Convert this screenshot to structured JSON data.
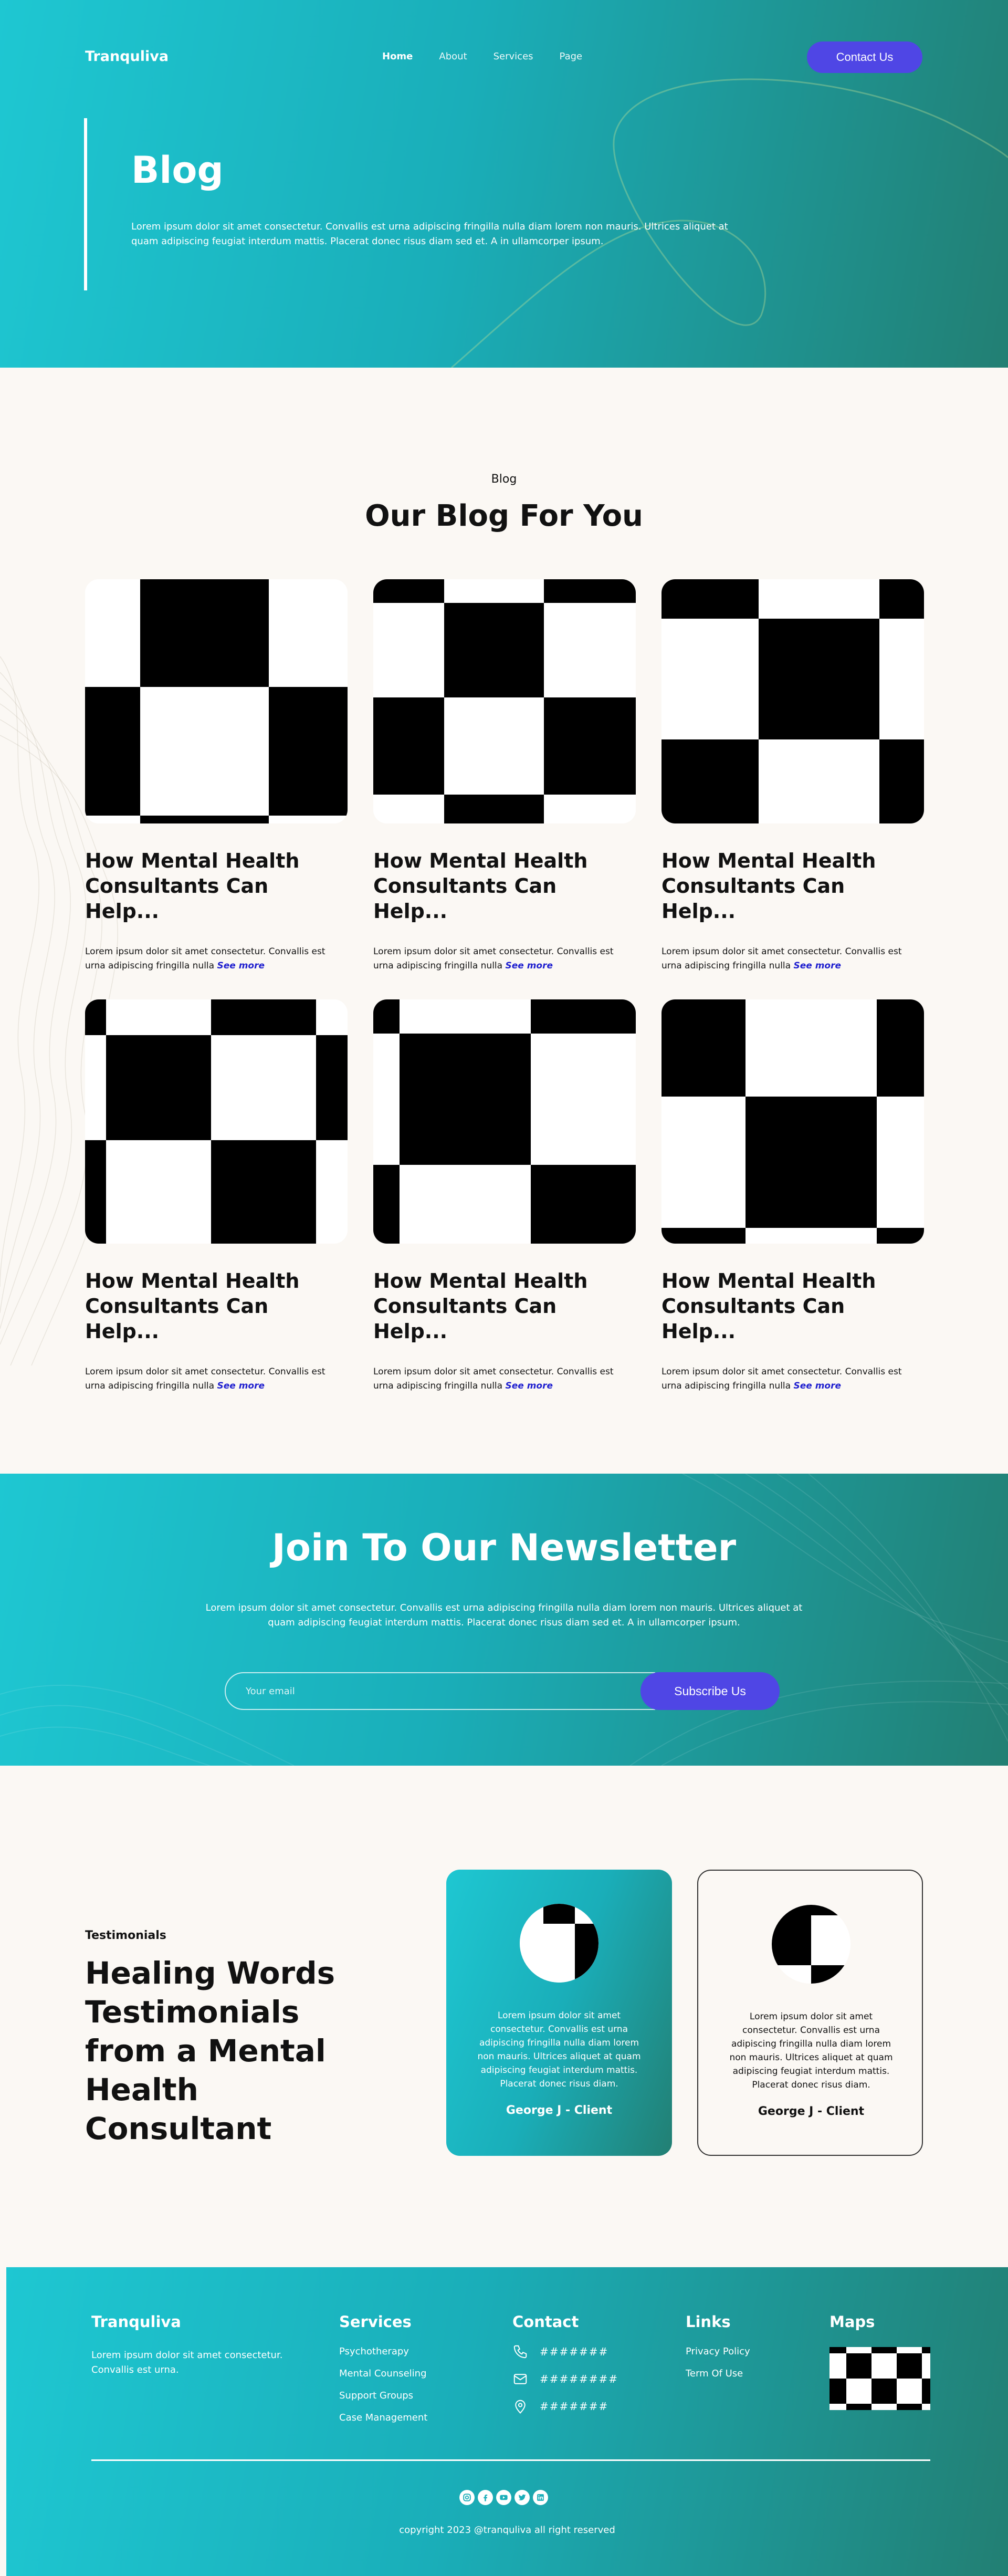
{
  "nav": {
    "brand": "Tranquliva",
    "links": [
      "Home",
      "About",
      "Services",
      "Page"
    ],
    "active": "Home",
    "contact_label": "Contact Us"
  },
  "hero": {
    "title": "Blog",
    "text": "Lorem ipsum dolor sit amet consectetur. Convallis est urna adipiscing fringilla nulla diam lorem non mauris. Ultrices aliquet at quam adipiscing feugiat interdum mattis. Placerat donec risus diam sed et. A in ullamcorper ipsum."
  },
  "blog": {
    "eyebrow": "Blog",
    "heading": "Our Blog For You",
    "cards": [
      {
        "title": "How Mental Health Consultants Can Help...",
        "excerpt": "Lorem ipsum dolor sit amet consectetur. Convallis est urna adipiscing fringilla nulla",
        "more": "See more",
        "image": "checker-pattern-image"
      },
      {
        "title": "How Mental Health Consultants Can Help...",
        "excerpt": "Lorem ipsum dolor sit amet consectetur. Convallis est urna adipiscing fringilla nulla",
        "more": "See more",
        "image": "checker-pattern-image"
      },
      {
        "title": "How Mental Health Consultants Can Help...",
        "excerpt": "Lorem ipsum dolor sit amet consectetur. Convallis est urna adipiscing fringilla nulla",
        "more": "See more",
        "image": "checker-pattern-image"
      },
      {
        "title": "How Mental Health Consultants Can Help...",
        "excerpt": "Lorem ipsum dolor sit amet consectetur. Convallis est urna adipiscing fringilla nulla",
        "more": "See more",
        "image": "checker-pattern-image"
      },
      {
        "title": "How Mental Health Consultants Can Help...",
        "excerpt": "Lorem ipsum dolor sit amet consectetur. Convallis est urna adipiscing fringilla nulla",
        "more": "See more",
        "image": "checker-pattern-image"
      },
      {
        "title": "How Mental Health Consultants Can Help...",
        "excerpt": "Lorem ipsum dolor sit amet consectetur. Convallis est urna adipiscing fringilla nulla",
        "more": "See more",
        "image": "checker-pattern-image"
      }
    ]
  },
  "newsletter": {
    "title": "Join To Our Newsletter",
    "text": "Lorem ipsum dolor sit amet consectetur. Convallis est urna adipiscing fringilla nulla diam lorem non mauris. Ultrices aliquet at quam adipiscing feugiat interdum mattis. Placerat donec risus diam sed et. A in ullamcorper ipsum.",
    "placeholder": "Your email",
    "button": "Subscribe Us"
  },
  "testimonials": {
    "eyebrow": "Testimonials",
    "heading": "Healing Words Testimonials from a Mental Health Consultant",
    "items": [
      {
        "quote": "Lorem ipsum dolor sit amet consectetur. Convallis est urna adipiscing fringilla nulla diam lorem non mauris. Ultrices aliquet at quam adipiscing feugiat interdum mattis. Placerat donec risus diam.",
        "name": "George J - Client"
      },
      {
        "quote": "Lorem ipsum dolor sit amet consectetur. Convallis est urna adipiscing fringilla nulla diam lorem non mauris. Ultrices aliquet at quam adipiscing feugiat interdum mattis. Placerat donec risus diam.",
        "name": "George J - Client"
      }
    ]
  },
  "footer": {
    "brand": "Tranquliva",
    "brand_text": "Lorem ipsum dolor sit amet consectetur. Convallis est urna.",
    "services_title": "Services",
    "services": [
      "Psychotherapy",
      "Mental Counseling",
      "Support Groups",
      "Case Management"
    ],
    "contact_title": "Contact",
    "contact": [
      {
        "icon": "phone-icon",
        "value": "#######"
      },
      {
        "icon": "mail-icon",
        "value": "########"
      },
      {
        "icon": "location-pin-icon",
        "value": "#######"
      }
    ],
    "links_title": "Links",
    "links": [
      "Privacy Policy",
      "Term Of Use"
    ],
    "maps_title": "Maps",
    "socials": [
      "instagram-icon",
      "facebook-icon",
      "youtube-icon",
      "twitter-icon",
      "linkedin-icon"
    ],
    "copyright": "copyright 2023 @tranquliva all right reserved"
  },
  "colors": {
    "accent": "#4f46e5",
    "teal_light": "#1ec7d2",
    "teal_dark": "#227f73",
    "background": "#fbf8f4",
    "link": "#1f1fcf"
  }
}
